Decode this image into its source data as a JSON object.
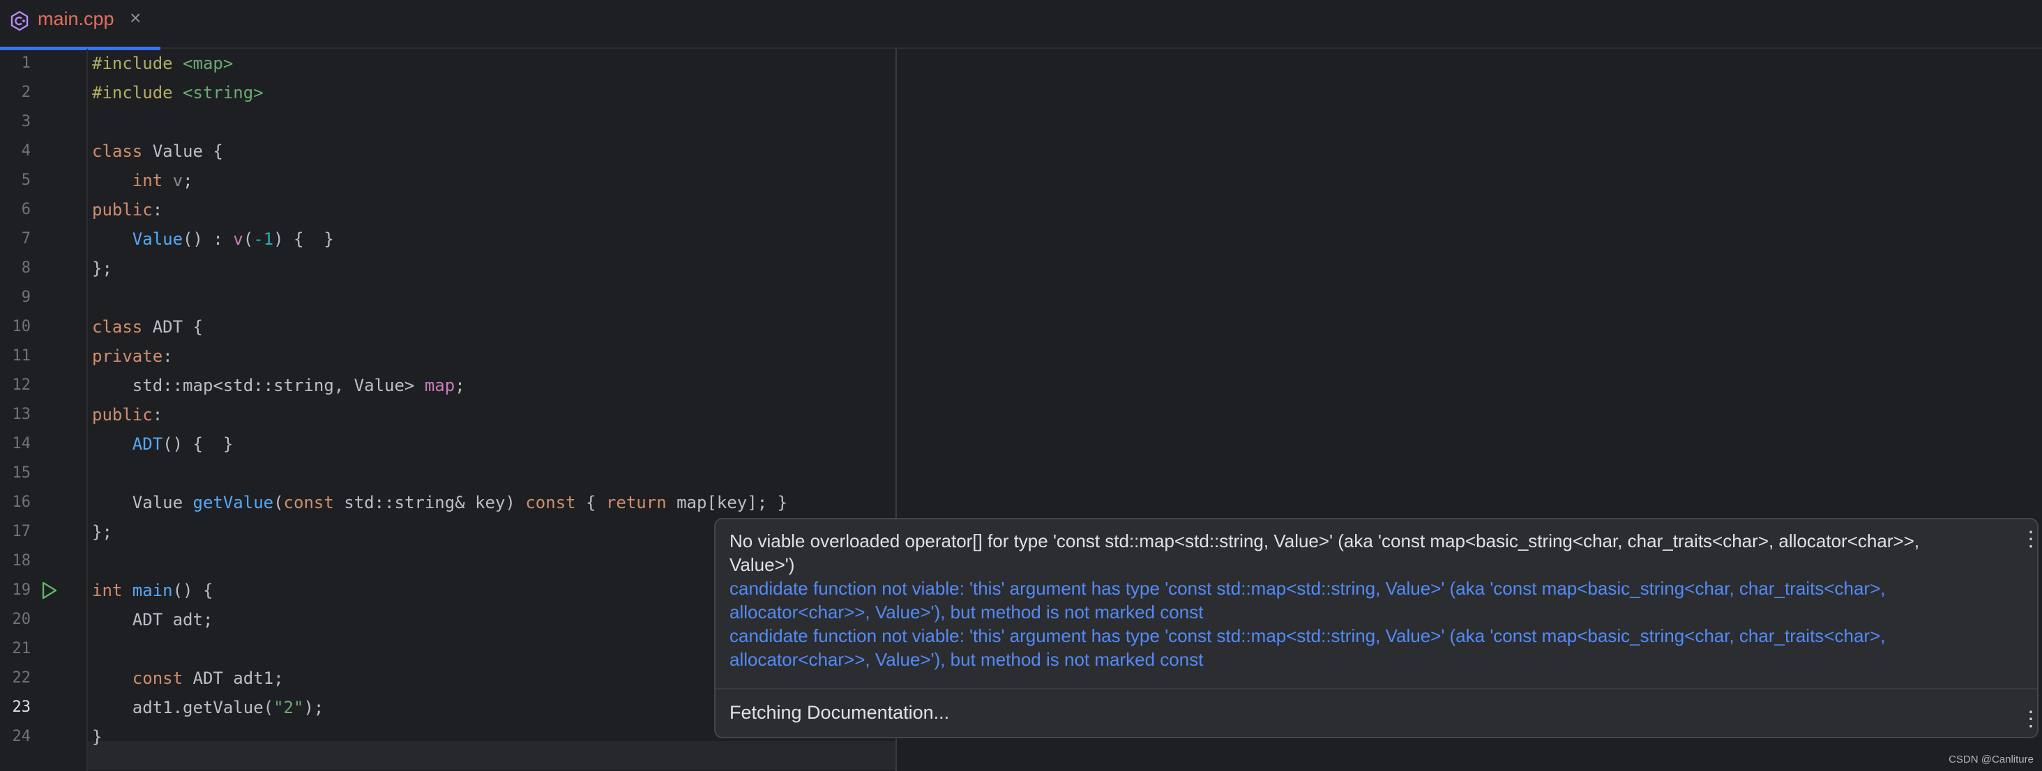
{
  "tab": {
    "label": "main.cpp",
    "close": "×"
  },
  "gutter": {
    "line_numbers": [
      "1",
      "2",
      "3",
      "4",
      "5",
      "6",
      "7",
      "8",
      "9",
      "10",
      "11",
      "12",
      "13",
      "14",
      "15",
      "16",
      "17",
      "18",
      "19",
      "20",
      "21",
      "22",
      "23",
      "24"
    ],
    "current_line": "23"
  },
  "code": {
    "l1_a": "#include ",
    "l1_b": "<map>",
    "l2_a": "#include ",
    "l2_b": "<string>",
    "l4_kw": "class",
    "l4_rest": " Value {",
    "l5_kw": "    int",
    "l5_v": " v",
    "l5_end": ";",
    "l6_kw": "public",
    "l6_end": ":",
    "l7_fn": "    Value",
    "l7_a": "() : ",
    "l7_v": "v",
    "l7_b": "(",
    "l7_num": "-1",
    "l7_c": ") {  }",
    "l8": "};",
    "l10_kw": "class",
    "l10_rest": " ADT {",
    "l11_kw": "private",
    "l11_end": ":",
    "l12_a": "    std::map<std::string, Value> ",
    "l12_field": "map",
    "l12_end": ";",
    "l13_kw": "public",
    "l13_end": ":",
    "l14_fn": "    ADT",
    "l14_rest": "() {  }",
    "l16_a": "    Value ",
    "l16_fn": "getValue",
    "l16_b": "(",
    "l16_kw1": "const",
    "l16_c": " std::string& key) ",
    "l16_kw2": "const",
    "l16_d": " { ",
    "l16_kw3": "return",
    "l16_e": " map[key]; }",
    "l17": "};",
    "l19_kw": "int",
    "l19_fn": " main",
    "l19_rest": "() {",
    "l20": "    ADT adt;",
    "l22_kw": "    const",
    "l22_rest": " ADT adt1;",
    "l23_a": "    adt1.getValue(",
    "l23_str": "\"2\"",
    "l23_b": ");",
    "l24": "}"
  },
  "popup": {
    "title": "No viable overloaded operator[] for type 'const std::map<std::string, Value>' (aka 'const map<basic_string<char, char_traits<char>, allocator<char>>, Value>')",
    "candidate1": "candidate function not viable: 'this' argument has type 'const std::map<std::string, Value>' (aka 'const map<basic_string<char, char_traits<char>, allocator<char>>, Value>'), but method is not marked const",
    "candidate2": "candidate function not viable: 'this' argument has type 'const std::map<std::string, Value>' (aka 'const map<basic_string<char, char_traits<char>, allocator<char>>, Value>'), but method is not marked const",
    "footer": "Fetching Documentation...",
    "menu_glyph": "⋮"
  },
  "watermark": "CSDN @Canliture",
  "colors": {
    "accent": "#3574f0",
    "tab_label": "#e26f5f",
    "candidate_link": "#548af7",
    "background": "#1e1f22",
    "run_icon": "#5fb865"
  },
  "icons": {
    "file_icon": "cpp-file-icon",
    "run_icon": "run-gutter-icon"
  }
}
